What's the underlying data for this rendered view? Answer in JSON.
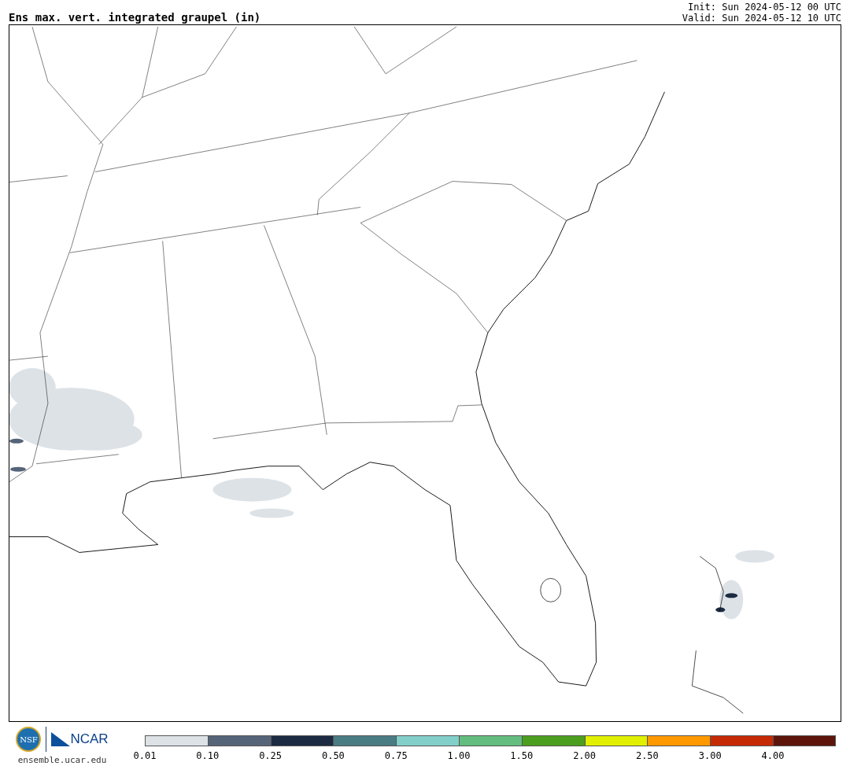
{
  "title": "Ens max. vert. integrated graupel (in)",
  "init": "Init: Sun 2024-05-12 00 UTC",
  "valid": "Valid: Sun 2024-05-12 10 UTC",
  "logos": {
    "nsf": "NSF",
    "ncar": "NCAR",
    "url": "ensemble.ucar.edu"
  },
  "legend": [
    {
      "label": "0.01",
      "color": "#dde2e7"
    },
    {
      "label": "0.10",
      "color": "#56647a"
    },
    {
      "label": "0.25",
      "color": "#1c2b42"
    },
    {
      "label": "0.50",
      "color": "#4a7c84"
    },
    {
      "label": "0.75",
      "color": "#82cfc9"
    },
    {
      "label": "1.00",
      "color": "#64bd7e"
    },
    {
      "label": "1.50",
      "color": "#4c9f1e"
    },
    {
      "label": "2.00",
      "color": "#e0f000"
    },
    {
      "label": "2.50",
      "color": "#ff9900"
    },
    {
      "label": "3.00",
      "color": "#c62a05"
    },
    {
      "label": "4.00",
      "color": "#5e1509"
    }
  ]
}
